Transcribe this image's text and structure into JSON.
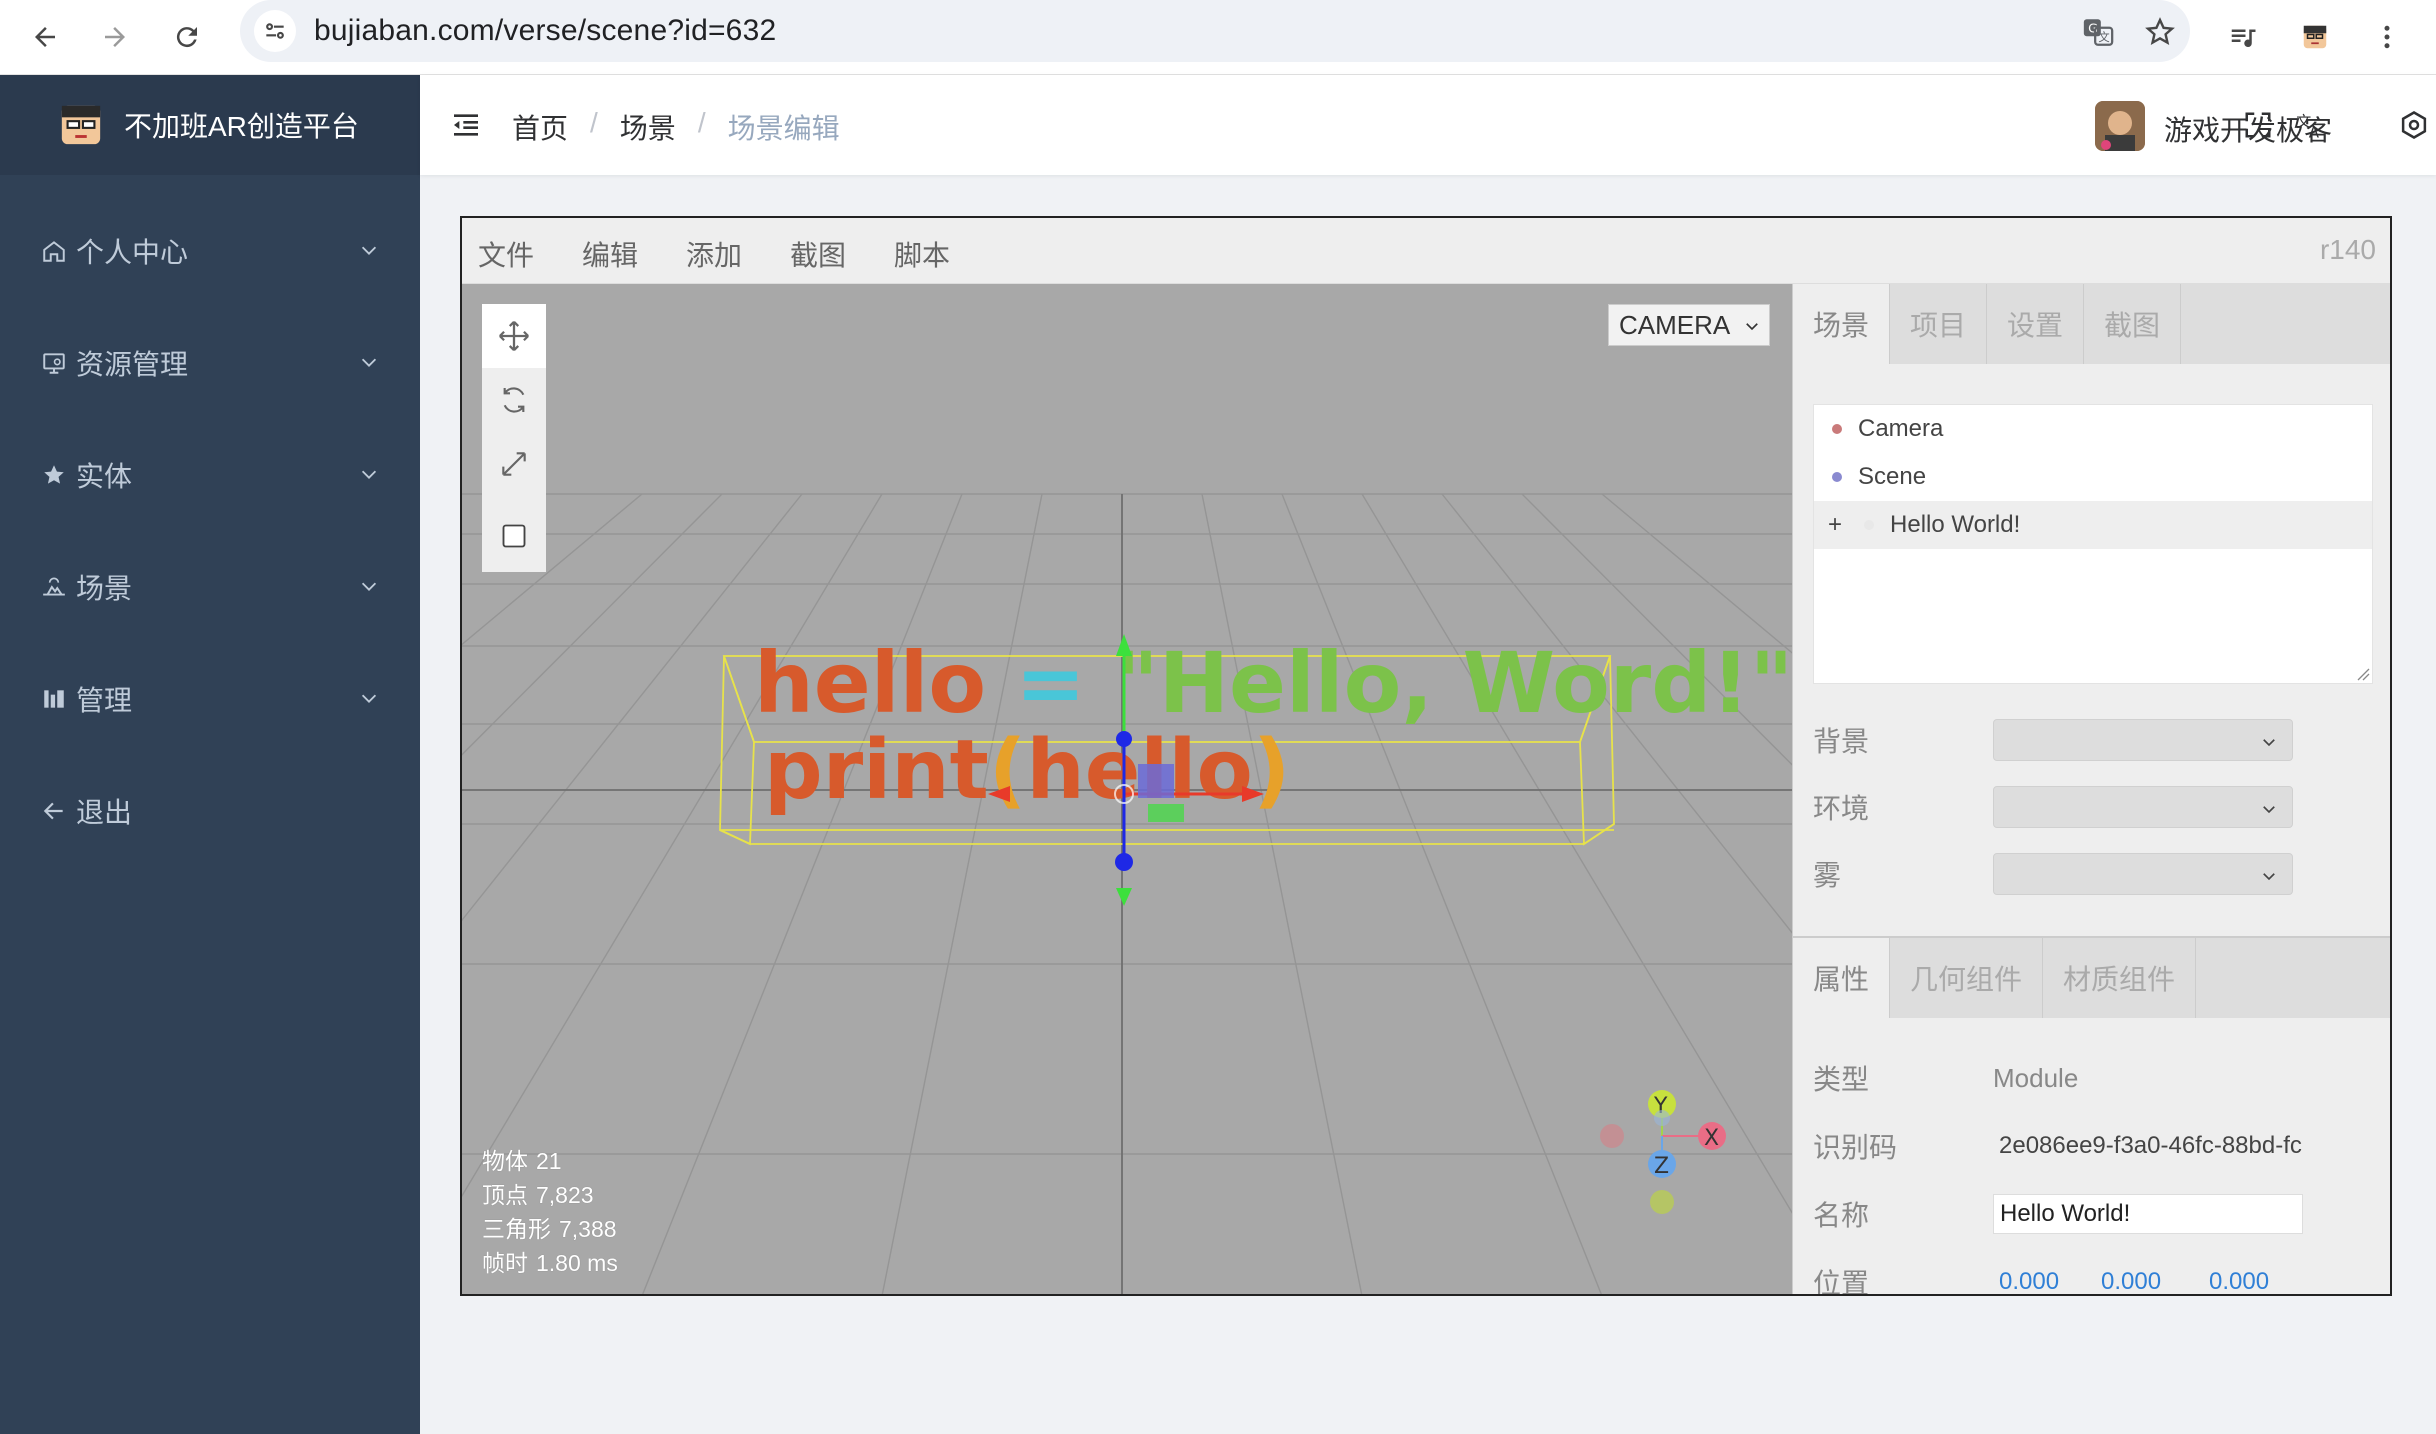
{
  "browser": {
    "url": "bujiaban.com/verse/scene?id=632"
  },
  "sidebar": {
    "brand_title": "不加班AR创造平台",
    "items": [
      {
        "label": "个人中心",
        "icon": "home-icon"
      },
      {
        "label": "资源管理",
        "icon": "monitor-icon"
      },
      {
        "label": "实体",
        "icon": "star-icon"
      },
      {
        "label": "场景",
        "icon": "scene-icon"
      },
      {
        "label": "管理",
        "icon": "chart-icon"
      },
      {
        "label": "退出",
        "icon": "arrow-left-icon"
      }
    ]
  },
  "header": {
    "breadcrumb": [
      "首页",
      "场景",
      "场景编辑"
    ],
    "username": "游戏开发极客"
  },
  "editor": {
    "menu": [
      "文件",
      "编辑",
      "添加",
      "截图",
      "脚本"
    ],
    "version": "r140",
    "camera_select": "CAMERA",
    "stats": [
      {
        "label": "物体",
        "value": "21"
      },
      {
        "label": "顶点",
        "value": "7,823"
      },
      {
        "label": "三角形",
        "value": "7,388"
      },
      {
        "label": "帧时",
        "value": "1.80 ms"
      }
    ],
    "scene_text_line1": "hello = \"Hello, Word!\"",
    "scene_text_line2": "print(hello)",
    "axis_labels": {
      "x": "X",
      "y": "Y",
      "z": "Z"
    }
  },
  "panel": {
    "top_tabs": [
      "场景",
      "项目",
      "设置",
      "截图"
    ],
    "outliner": [
      {
        "label": "Camera",
        "dot_color": "#c97a7a"
      },
      {
        "label": "Scene",
        "dot_color": "#8a8ad0"
      },
      {
        "label": "Hello World!",
        "dot_color": "#e8e8e8",
        "prefix": "+"
      }
    ],
    "scene_props": [
      {
        "label": "背景"
      },
      {
        "label": "环境"
      },
      {
        "label": "雾"
      }
    ],
    "bottom_tabs": [
      "属性",
      "几何组件",
      "材质组件"
    ],
    "object": {
      "type_label": "类型",
      "type_value": "Module",
      "uuid_label": "识别码",
      "uuid_value": "2e086ee9-f3a0-46fc-88bd-fc",
      "name_label": "名称",
      "name_value": "Hello World!",
      "position_label": "位置",
      "position": [
        "0.000",
        "0.000",
        "0.000"
      ]
    }
  }
}
